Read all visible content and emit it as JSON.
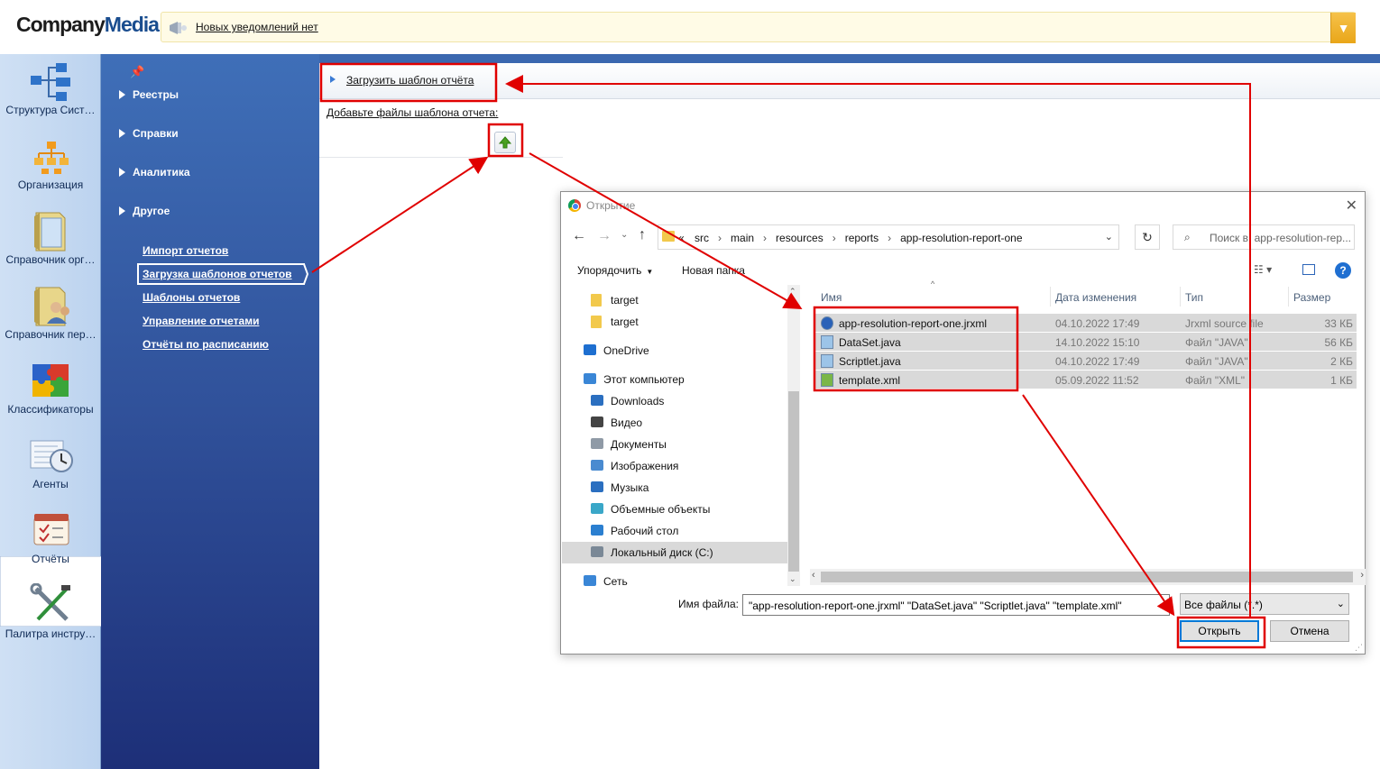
{
  "header": {
    "logo_part1": "Company",
    "logo_part2": "Media",
    "notification_text": "Новых уведомлений нет",
    "notification_dropdown_icon": "chevron-down-icon"
  },
  "rail": {
    "items": [
      {
        "label": "Структура Сист…",
        "icon": "structure-icon"
      },
      {
        "label": "Организация",
        "icon": "organization-icon"
      },
      {
        "label": "Справочник орг…",
        "icon": "org-directory-icon"
      },
      {
        "label": "Справочник пер…",
        "icon": "people-directory-icon"
      },
      {
        "label": "Классификаторы",
        "icon": "puzzle-icon"
      },
      {
        "label": "Агенты",
        "icon": "agents-icon"
      },
      {
        "label": "Отчёты",
        "icon": "reports-icon"
      },
      {
        "label": "Палитра инстру…",
        "icon": "tools-icon"
      }
    ],
    "active_index": 6
  },
  "nav": {
    "groups": [
      "Реестры",
      "Справки",
      "Аналитика",
      "Другое"
    ],
    "links": [
      "Импорт отчетов",
      "Загрузка шаблонов отчетов",
      "Шаблоны отчетов",
      "Управление отчетами",
      "Отчёты по расписанию"
    ],
    "active_link_index": 1
  },
  "main": {
    "toolbar_upload": "Загрузить шаблон отчёта",
    "add_files_label": "Добавьте файлы шаблона отчета:"
  },
  "dialog": {
    "title": "Открытие",
    "breadcrumbs": [
      "«",
      "src",
      "main",
      "resources",
      "reports",
      "app-resolution-report-one"
    ],
    "search_placeholder": "Поиск в: app-resolution-rep...",
    "organize": "Упорядочить",
    "new_folder": "Новая папка",
    "tree": [
      {
        "label": "target",
        "icon": "folder-icon",
        "indent": 1
      },
      {
        "label": "target",
        "icon": "folder-icon",
        "indent": 1
      },
      {
        "label": "OneDrive",
        "icon": "cloud-icon",
        "indent": 0
      },
      {
        "label": "Этот компьютер",
        "icon": "computer-icon",
        "indent": 0
      },
      {
        "label": "Downloads",
        "icon": "download-icon",
        "indent": 1
      },
      {
        "label": "Видео",
        "icon": "video-icon",
        "indent": 1
      },
      {
        "label": "Документы",
        "icon": "documents-icon",
        "indent": 1
      },
      {
        "label": "Изображения",
        "icon": "images-icon",
        "indent": 1
      },
      {
        "label": "Музыка",
        "icon": "music-icon",
        "indent": 1
      },
      {
        "label": "Объемные объекты",
        "icon": "3d-objects-icon",
        "indent": 1
      },
      {
        "label": "Рабочий стол",
        "icon": "desktop-icon",
        "indent": 1
      },
      {
        "label": "Локальный диск (C:)",
        "icon": "drive-icon",
        "indent": 1,
        "selected": true
      },
      {
        "label": "Сеть",
        "icon": "network-icon",
        "indent": 0
      }
    ],
    "columns": [
      "Имя",
      "Дата изменения",
      "Тип",
      "Размер"
    ],
    "files": [
      {
        "name": "app-resolution-report-one.jrxml",
        "date": "04.10.2022 17:49",
        "type": "Jrxml source file",
        "size": "33 КБ",
        "icon": "jrxml-file-icon"
      },
      {
        "name": "DataSet.java",
        "date": "14.10.2022 15:10",
        "type": "Файл \"JAVA\"",
        "size": "56 КБ",
        "icon": "java-file-icon"
      },
      {
        "name": "Scriptlet.java",
        "date": "04.10.2022 17:49",
        "type": "Файл \"JAVA\"",
        "size": "2 КБ",
        "icon": "java-file-icon"
      },
      {
        "name": "template.xml",
        "date": "05.09.2022 11:52",
        "type": "Файл \"XML\"",
        "size": "1 КБ",
        "icon": "xml-file-icon"
      }
    ],
    "filename_label": "Имя файла:",
    "filename_value": "\"app-resolution-report-one.jrxml\" \"DataSet.java\" \"Scriptlet.java\" \"template.xml\"",
    "filetype_value": "Все файлы (*.*)",
    "open_button": "Открыть",
    "cancel_button": "Отмена"
  },
  "annotation_color": "#e00000"
}
